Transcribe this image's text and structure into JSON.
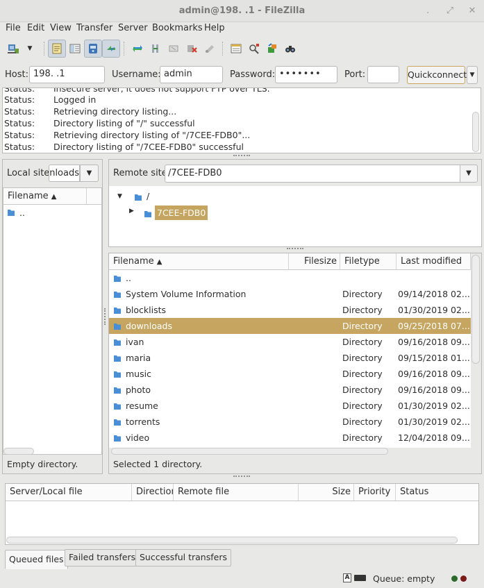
{
  "window": {
    "title": "admin@198.        .1 - FileZilla"
  },
  "menu": [
    "File",
    "Edit",
    "View",
    "Transfer",
    "Server",
    "Bookmarks",
    "Help"
  ],
  "toolbar": {
    "icons": [
      "site-manager",
      "dropdown",
      "toggle-log",
      "toggle-local-tree",
      "toggle-remote-tree",
      "toggle-queue",
      "refresh",
      "process-queue",
      "cancel",
      "disconnect",
      "reconnect",
      "directory-listing-filters",
      "toggle-comparison",
      "sync-browsing",
      "search-remote-files"
    ]
  },
  "quickconnect": {
    "host_label": "Host:",
    "host_value": "198.        .1",
    "username_label": "Username:",
    "username_value": "admin",
    "password_label": "Password:",
    "password_value": "•••••••",
    "port_label": "Port:",
    "port_value": "",
    "button": "Quickconnect"
  },
  "log": [
    {
      "key": "Status:",
      "msg": "Insecure server, it does not support FTP over TLS."
    },
    {
      "key": "Status:",
      "msg": "Logged in"
    },
    {
      "key": "Status:",
      "msg": "Retrieving directory listing..."
    },
    {
      "key": "Status:",
      "msg": "Directory listing of \"/\" successful"
    },
    {
      "key": "Status:",
      "msg": "Retrieving directory listing of \"/7CEE-FDB0\"..."
    },
    {
      "key": "Status:",
      "msg": "Directory listing of \"/7CEE-FDB0\" successful"
    }
  ],
  "local": {
    "site_label": "Local site:",
    "site_value": "nloads/",
    "col_filename": "Filename",
    "files": [
      ".."
    ],
    "status": "Empty directory."
  },
  "remote": {
    "site_label": "Remote site:",
    "site_value": "/7CEE-FDB0",
    "tree": [
      {
        "name": "/",
        "selected": false
      },
      {
        "name": "7CEE-FDB0",
        "selected": true
      }
    ],
    "columns": [
      "Filename",
      "Filesize",
      "Filetype",
      "Last modified"
    ],
    "files": [
      {
        "name": "..",
        "type": "",
        "modified": ""
      },
      {
        "name": "System Volume Information",
        "type": "Directory",
        "modified": "09/14/2018 02..."
      },
      {
        "name": "blocklists",
        "type": "Directory",
        "modified": "01/30/2019 02..."
      },
      {
        "name": "downloads",
        "type": "Directory",
        "modified": "09/25/2018 07...",
        "selected": true
      },
      {
        "name": "ivan",
        "type": "Directory",
        "modified": "09/16/2018 09..."
      },
      {
        "name": "maria",
        "type": "Directory",
        "modified": "09/15/2018 01..."
      },
      {
        "name": "music",
        "type": "Directory",
        "modified": "09/16/2018 09..."
      },
      {
        "name": "photo",
        "type": "Directory",
        "modified": "09/16/2018 09..."
      },
      {
        "name": "resume",
        "type": "Directory",
        "modified": "01/30/2019 02..."
      },
      {
        "name": "torrents",
        "type": "Directory",
        "modified": "01/30/2019 02..."
      },
      {
        "name": "video",
        "type": "Directory",
        "modified": "12/04/2018 09..."
      }
    ],
    "status": "Selected 1 directory."
  },
  "queue": {
    "columns": [
      "Server/Local file",
      "Direction",
      "Remote file",
      "Size",
      "Priority",
      "Status"
    ],
    "tabs": [
      "Queued files",
      "Failed transfers",
      "Successful transfers"
    ],
    "status": "Queue: empty"
  },
  "colors": {
    "selection": "#c5a560",
    "folder": "#4a8fd6"
  }
}
